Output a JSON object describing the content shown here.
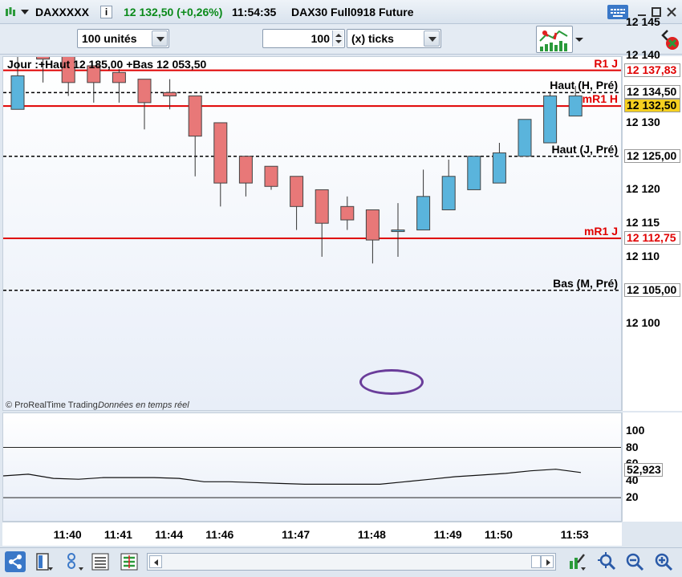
{
  "titlebar": {
    "instrument": "DAXXXXX",
    "price": "12 132,50 (+0,26%)",
    "time": "11:54:35",
    "description": "DAX30 Full0918 Future",
    "colors": {
      "price": "#0a8a1a"
    }
  },
  "toolbar": {
    "units_select": "100 unités",
    "ticks_value": "100",
    "ticks_mode": "(x) ticks"
  },
  "chart": {
    "header": "Jour :+Haut 12 185,00 +Bas 12 053,50",
    "footer_brand": "© ProRealTime Trading",
    "footer_status": "Données en temps réel",
    "price_ticks": [
      "12 145",
      "12 140",
      "12 130",
      "12 120",
      "12 115",
      "12 110",
      "12 100"
    ],
    "levels": [
      {
        "name": "R1 J",
        "value": "12 137,83",
        "color": "#e00000",
        "style": "solid"
      },
      {
        "name": "Haut (H, Pré)",
        "value": "12 134,50",
        "color": "#000000",
        "style": "dashed"
      },
      {
        "name": "mR1 H",
        "value": "12 132,50",
        "color": "#e00000",
        "style": "solid"
      },
      {
        "name": "Haut (J, Pré)",
        "value": "12 125,00",
        "color": "#000000",
        "style": "dashed"
      },
      {
        "name": "mR1 J",
        "value": "12 112,75",
        "color": "#e00000",
        "style": "solid"
      },
      {
        "name": "Bas (M, Pré)",
        "value": "12 105,00",
        "color": "#000000",
        "style": "dashed"
      }
    ],
    "last_price": "12 132,50",
    "last_price_bg": "#f5d020",
    "bull_color": "#5ab4dc",
    "bear_color": "#e87878"
  },
  "chart_data": {
    "type": "candlestick",
    "ylim": [
      12097,
      12152
    ],
    "candles": [
      {
        "o": 12132,
        "h": 12148,
        "l": 12132,
        "c": 12137
      },
      {
        "o": 12140,
        "h": 12144,
        "l": 12136,
        "c": 12139.5
      },
      {
        "o": 12140,
        "h": 12140,
        "l": 12134,
        "c": 12136
      },
      {
        "o": 12138.5,
        "h": 12138.5,
        "l": 12133,
        "c": 12136
      },
      {
        "o": 12137.5,
        "h": 12138,
        "l": 12133,
        "c": 12136
      },
      {
        "o": 12136.5,
        "h": 12136.5,
        "l": 12129,
        "c": 12133
      },
      {
        "o": 12134.5,
        "h": 12136.5,
        "l": 12132,
        "c": 12134
      },
      {
        "o": 12134,
        "h": 12134,
        "l": 12122,
        "c": 12128
      },
      {
        "o": 12130,
        "h": 12130,
        "l": 12117.5,
        "c": 12121
      },
      {
        "o": 12125,
        "h": 12125,
        "l": 12119,
        "c": 12121
      },
      {
        "o": 12123.5,
        "h": 12123.5,
        "l": 12120,
        "c": 12120.5
      },
      {
        "o": 12122,
        "h": 12122,
        "l": 12114,
        "c": 12117.5
      },
      {
        "o": 12120,
        "h": 12120,
        "l": 12110,
        "c": 12115
      },
      {
        "o": 12117.5,
        "h": 12119,
        "l": 12114,
        "c": 12115.5
      },
      {
        "o": 12117,
        "h": 12117,
        "l": 12109,
        "c": 12112.5
      },
      {
        "o": 12114,
        "h": 12118,
        "l": 12110,
        "c": 12114
      },
      {
        "o": 12114,
        "h": 12123,
        "l": 12114,
        "c": 12119
      },
      {
        "o": 12117,
        "h": 12124.5,
        "l": 12117,
        "c": 12122
      },
      {
        "o": 12120,
        "h": 12125,
        "l": 12120,
        "c": 12125
      },
      {
        "o": 12121,
        "h": 12127,
        "l": 12121,
        "c": 12125.5
      },
      {
        "o": 12125,
        "h": 12129,
        "l": 12125,
        "c": 12130.5
      },
      {
        "o": 12127,
        "h": 12134.5,
        "l": 12127,
        "c": 12134
      },
      {
        "o": 12131,
        "h": 12135.5,
        "l": 12131,
        "c": 12134
      }
    ],
    "x_ticks": [
      "11:40",
      "11:41",
      "11:44",
      "11:46",
      "11:47",
      "11:48",
      "11:49",
      "11:50",
      "11:53"
    ],
    "oscillator": {
      "ylim": [
        0,
        115
      ],
      "ticks": [
        "100",
        "80",
        "60",
        "40",
        "20"
      ],
      "levels": [
        80,
        20
      ],
      "last_value": "52,923",
      "values": [
        46,
        48,
        43,
        42,
        44,
        44,
        44,
        43,
        39,
        39,
        38,
        37,
        36,
        36,
        36,
        36,
        39,
        42,
        45,
        47,
        49,
        52,
        54,
        50
      ]
    }
  },
  "icons": {
    "toolbar": [
      "chart-type-icon"
    ],
    "titlebar": [
      "menu-icon",
      "info-icon",
      "keyboard-icon",
      "minimize-icon",
      "maximize-icon",
      "close-icon"
    ],
    "bottom": [
      "share-icon",
      "layout-icon",
      "indicators-icon",
      "list-icon",
      "table-icon",
      "tools-icon",
      "autoscale-icon",
      "zoom-out-icon",
      "zoom-in-icon"
    ]
  }
}
